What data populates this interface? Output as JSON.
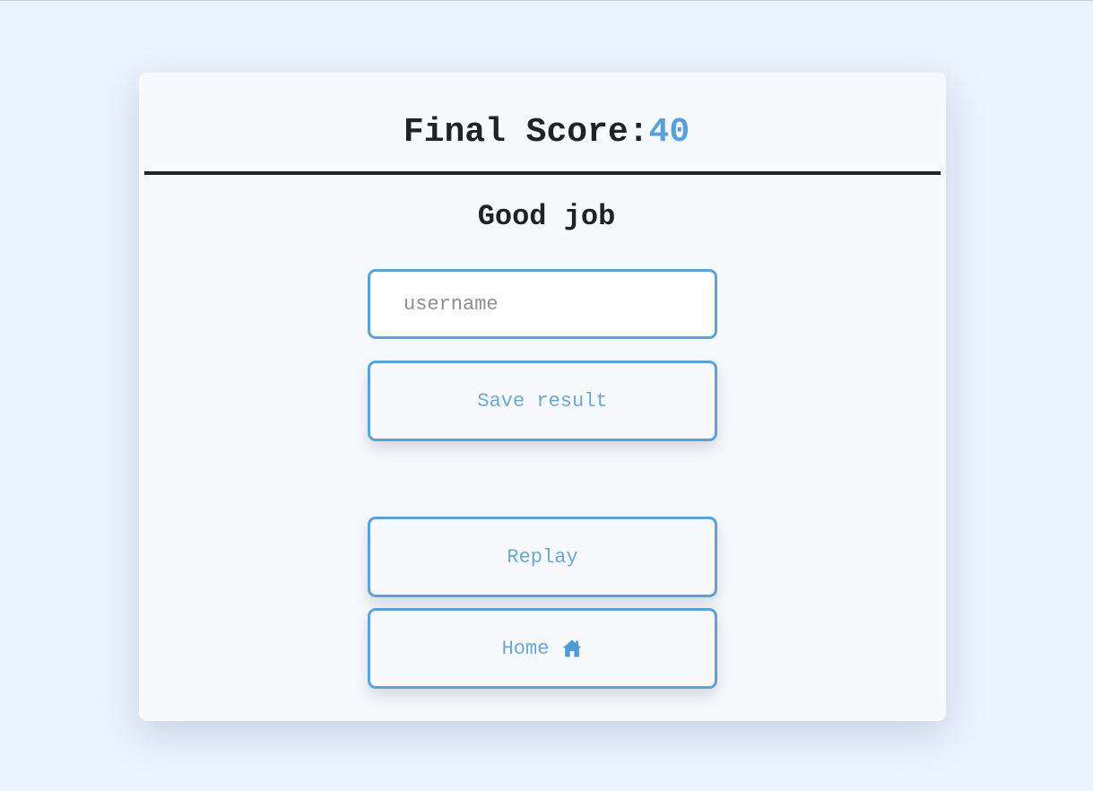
{
  "score": {
    "label": "Final Score:",
    "value": "40"
  },
  "message": "Good job",
  "form": {
    "username_placeholder": "username",
    "username_value": "",
    "save_label": "Save result"
  },
  "actions": {
    "replay_label": "Replay",
    "home_label": "Home",
    "home_icon": "home-icon"
  },
  "colors": {
    "accent": "#5aa2d8",
    "score_value": "#56a0dc",
    "background": "#ebf3fe",
    "card": "#f7f9fc",
    "text": "#1f2326"
  }
}
